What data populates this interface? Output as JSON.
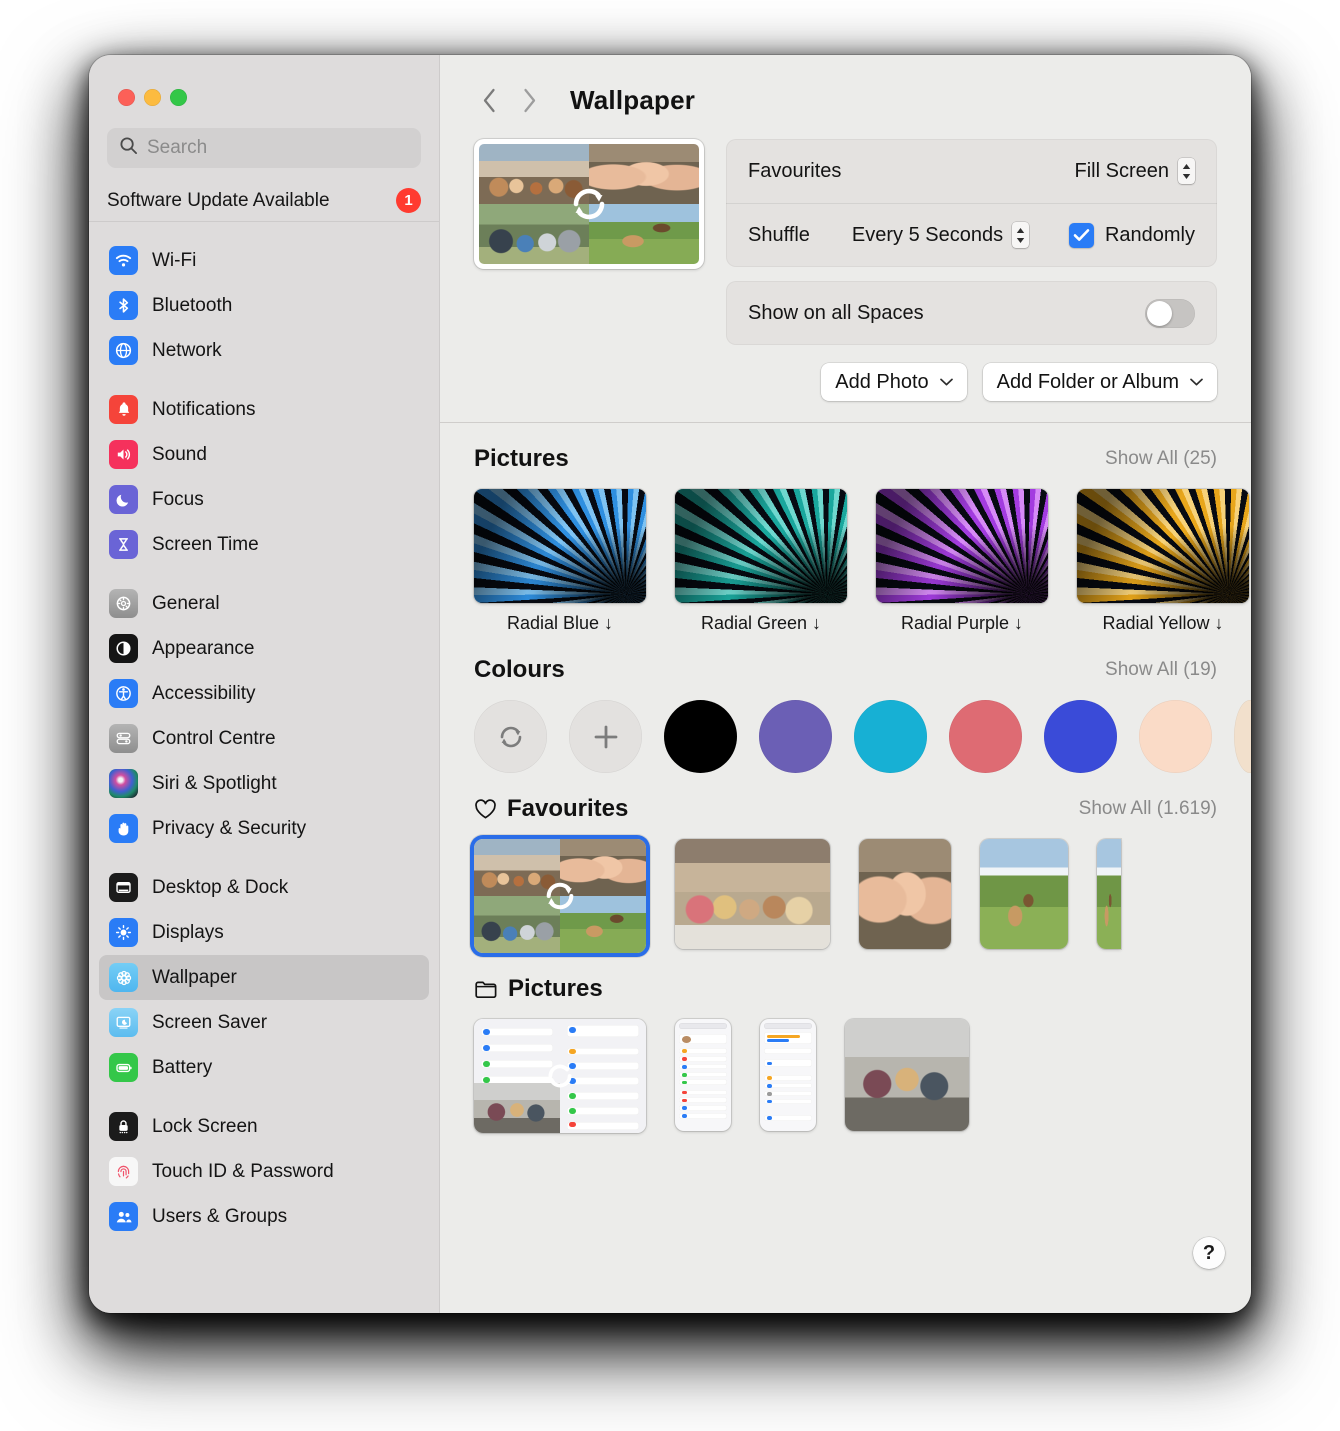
{
  "window": {
    "traffic_lights": [
      "close",
      "minimize",
      "zoom"
    ],
    "colors": {
      "close": "#fc6058",
      "minimize": "#fcbb40",
      "zoom": "#33c748"
    }
  },
  "sidebar": {
    "search": {
      "placeholder": "Search",
      "value": ""
    },
    "update": {
      "label": "Software Update Available",
      "badge": "1"
    },
    "groups": [
      {
        "items": [
          {
            "label": "Wi-Fi",
            "icon": "wifi-icon",
            "color": "#2a7cf6"
          },
          {
            "label": "Bluetooth",
            "icon": "bluetooth-icon",
            "color": "#2a7cf6"
          },
          {
            "label": "Network",
            "icon": "globe-icon",
            "color": "#2a7cf6"
          }
        ]
      },
      {
        "items": [
          {
            "label": "Notifications",
            "icon": "bell-icon",
            "color": "#f5443a"
          },
          {
            "label": "Sound",
            "icon": "speaker-icon",
            "color": "#f5315c"
          },
          {
            "label": "Focus",
            "icon": "moon-icon",
            "color": "#6a64d6"
          },
          {
            "label": "Screen Time",
            "icon": "hourglass-icon",
            "color": "#6a64d6"
          }
        ]
      },
      {
        "items": [
          {
            "label": "General",
            "icon": "gear-icon",
            "color": "#9a9a9a"
          },
          {
            "label": "Appearance",
            "icon": "contrast-icon",
            "color": "#151515"
          },
          {
            "label": "Accessibility",
            "icon": "accessibility-icon",
            "color": "#2a7cf6"
          },
          {
            "label": "Control Centre",
            "icon": "sliders-icon",
            "color": "#9a9a9a"
          },
          {
            "label": "Siri & Spotlight",
            "icon": "siri-icon",
            "color": "#2b2b3a"
          },
          {
            "label": "Privacy & Security",
            "icon": "hand-icon",
            "color": "#2a7cf6"
          }
        ]
      },
      {
        "items": [
          {
            "label": "Desktop & Dock",
            "icon": "desktop-icon",
            "color": "#1b1b1b"
          },
          {
            "label": "Displays",
            "icon": "brightness-icon",
            "color": "#2a7cf6"
          },
          {
            "label": "Wallpaper",
            "icon": "wallpaper-icon",
            "color": "#5ec2f0",
            "selected": true
          },
          {
            "label": "Screen Saver",
            "icon": "screensaver-icon",
            "color": "#6ec6ef"
          },
          {
            "label": "Battery",
            "icon": "battery-icon",
            "color": "#34c749"
          }
        ]
      },
      {
        "items": [
          {
            "label": "Lock Screen",
            "icon": "lock-icon",
            "color": "#1b1b1b"
          },
          {
            "label": "Touch ID & Password",
            "icon": "fingerprint-icon",
            "color": "#f7f7f7"
          },
          {
            "label": "Users & Groups",
            "icon": "users-icon",
            "color": "#2a7cf6"
          }
        ]
      }
    ]
  },
  "header": {
    "back": "‹",
    "forward": "›",
    "title": "Wallpaper"
  },
  "settings": {
    "source_label": "Favourites",
    "fit_value": "Fill Screen",
    "shuffle_label": "Shuffle",
    "shuffle_value": "Every 5 Seconds",
    "randomly_label": "Randomly",
    "randomly_checked": true,
    "spaces_label": "Show on all Spaces",
    "spaces_on": false,
    "add_photo": "Add Photo",
    "add_folder": "Add Folder or Album"
  },
  "pictures": {
    "title": "Pictures",
    "show_all": "Show All (25)",
    "items": [
      {
        "name": "Radial Blue ↓",
        "c1": "#2f8fe0",
        "c2": "#7fc3f2"
      },
      {
        "name": "Radial Green ↓",
        "c1": "#1aa79d",
        "c2": "#6fd8cf"
      },
      {
        "name": "Radial Purple ↓",
        "c1": "#a33ce0",
        "c2": "#d78bf7"
      },
      {
        "name": "Radial Yellow ↓",
        "c1": "#e8a61b",
        "c2": "#f7d27a"
      },
      {
        "name": "",
        "c1": "#e8641b",
        "c2": "#f7b07a"
      }
    ]
  },
  "colours": {
    "title": "Colours",
    "show_all": "Show All (19)",
    "actions": [
      {
        "name": "shuffle-colour-button"
      },
      {
        "name": "add-colour-button"
      }
    ],
    "swatches": [
      {
        "name": "black",
        "hex": "#000000"
      },
      {
        "name": "purple",
        "hex": "#6b5fb5"
      },
      {
        "name": "cyan",
        "hex": "#17b0d4"
      },
      {
        "name": "red",
        "hex": "#de6b73"
      },
      {
        "name": "blue",
        "hex": "#3a4bd8"
      },
      {
        "name": "peach",
        "hex": "#fadbc7"
      },
      {
        "name": "cream",
        "hex": "#f2e0cc"
      }
    ]
  },
  "favourites": {
    "title": "Favourites",
    "show_all": "Show All (1.619)",
    "items": [
      {
        "name": "collage-wallpaper",
        "selected": true
      },
      {
        "name": "party-photo",
        "selected": false
      },
      {
        "name": "selfie-photo",
        "selected": false
      },
      {
        "name": "meadow-horses-photo",
        "selected": false
      },
      {
        "name": "clipped-photo",
        "selected": false
      }
    ]
  },
  "pictures_folder": {
    "title": "Pictures",
    "items": [
      {
        "name": "ios-settings-screenshot-wide"
      },
      {
        "name": "ios-settings-screenshot-1"
      },
      {
        "name": "ios-settings-screenshot-2"
      },
      {
        "name": "highfive-photo"
      }
    ]
  },
  "help": {
    "label": "?"
  }
}
